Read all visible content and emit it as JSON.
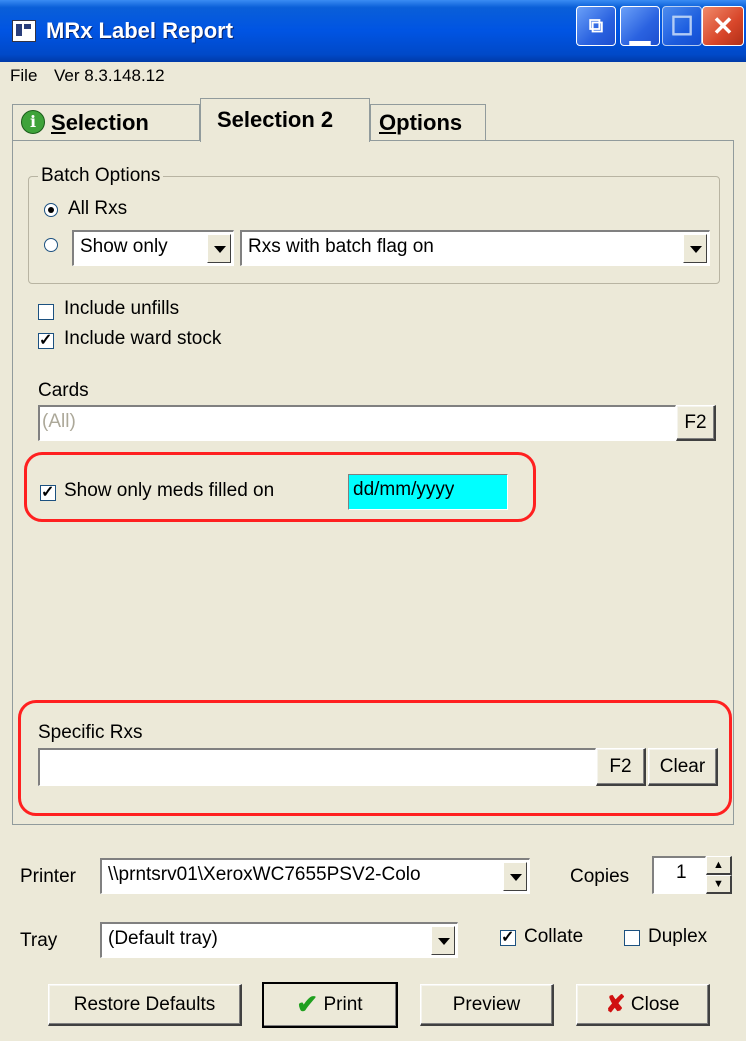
{
  "window": {
    "title": "MRx Label Report"
  },
  "menu": {
    "file": "File",
    "version": "Ver 8.3.148.12"
  },
  "tabs": [
    {
      "label": "Selection",
      "active": false
    },
    {
      "label": "Selection 2",
      "active": true
    },
    {
      "label": "Options",
      "active": false
    }
  ],
  "batch": {
    "group_label": "Batch Options",
    "all_rxs": "All Rxs",
    "show_mode": "Show only",
    "flag_option": "Rxs with batch flag on"
  },
  "checks": {
    "include_unfills": "Include unfills",
    "include_ward_stock": "Include ward stock"
  },
  "cards": {
    "label": "Cards",
    "value": "(All)",
    "f2": "F2"
  },
  "filled": {
    "label": "Show only meds filled on",
    "date": "dd/mm/yyyy"
  },
  "specific": {
    "label": "Specific Rxs",
    "f2": "F2",
    "clear": "Clear"
  },
  "printer": {
    "label": "Printer",
    "value": "\\\\prntsrv01\\XeroxWC7655PSV2-Colo",
    "copies_label": "Copies",
    "copies": "1"
  },
  "tray": {
    "label": "Tray",
    "value": "(Default tray)",
    "collate": "Collate",
    "duplex": "Duplex"
  },
  "buttons": {
    "restore": "Restore Defaults",
    "print": "Print",
    "preview": "Preview",
    "close": "Close"
  },
  "colors": {
    "date_highlight": "#00ffff",
    "annotation": "#ff2020"
  }
}
